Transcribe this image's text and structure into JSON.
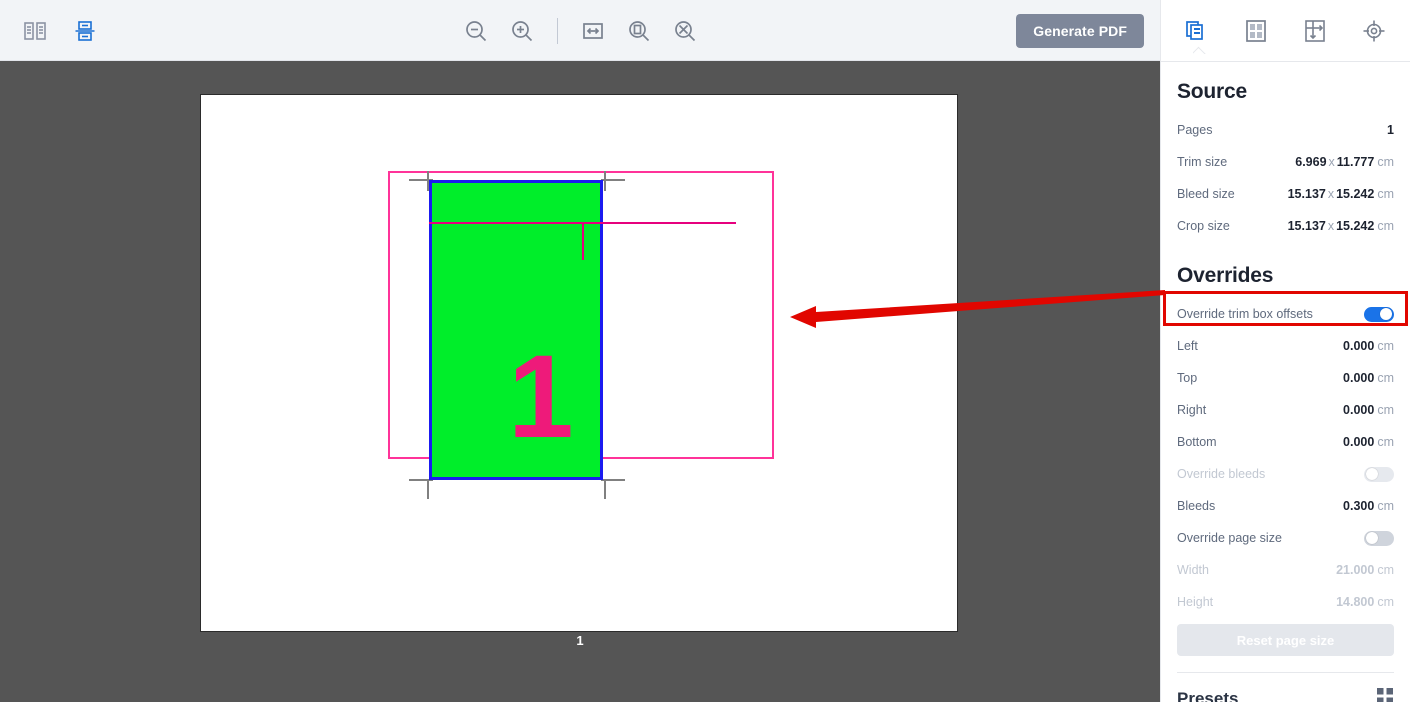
{
  "toolbar": {
    "left_icons": [
      {
        "name": "two-page-spread-icon",
        "state": "inactive"
      },
      {
        "name": "single-page-icon",
        "state": "active"
      }
    ],
    "center_icons": [
      {
        "name": "zoom-out-icon"
      },
      {
        "name": "zoom-in-icon"
      },
      {
        "name": "fit-width-icon"
      },
      {
        "name": "fit-page-icon"
      },
      {
        "name": "actual-size-icon"
      }
    ],
    "generate_pdf_label": "Generate PDF"
  },
  "canvas": {
    "page_label": "1",
    "artwork_numeral": "1",
    "colors": {
      "background": "#555555",
      "sheet": "#ffffff",
      "bleed_box": "#ff3399",
      "trim_box_border": "#1b1bf0",
      "artwork_fill": "#00ee2a",
      "crop_marks": "#808080",
      "guides": "#e6007e"
    }
  },
  "panel": {
    "tabs": [
      {
        "name": "source-tab",
        "icon": "stacked-pages-icon",
        "active": true
      },
      {
        "name": "layout-tab",
        "icon": "grid-pages-icon",
        "active": false
      },
      {
        "name": "offsets-tab",
        "icon": "offset-arrows-icon",
        "active": false
      },
      {
        "name": "marks-tab",
        "icon": "registration-target-icon",
        "active": false
      }
    ],
    "source": {
      "title": "Source",
      "rows": [
        {
          "label": "Pages",
          "value": "1",
          "unit": ""
        },
        {
          "label": "Trim size",
          "value_w": "6.969",
          "value_h": "11.777",
          "unit": "cm"
        },
        {
          "label": "Bleed size",
          "value_w": "15.137",
          "value_h": "15.242",
          "unit": "cm"
        },
        {
          "label": "Crop size",
          "value_w": "15.137",
          "value_h": "15.242",
          "unit": "cm"
        }
      ]
    },
    "overrides": {
      "title": "Overrides",
      "trim_toggle_label": "Override trim box offsets",
      "trim_toggle_state": "on",
      "left_label": "Left",
      "left_value": "0.000",
      "left_unit": "cm",
      "top_label": "Top",
      "top_value": "0.000",
      "top_unit": "cm",
      "right_label": "Right",
      "right_value": "0.000",
      "right_unit": "cm",
      "bottom_label": "Bottom",
      "bottom_value": "0.000",
      "bottom_unit": "cm",
      "bleeds_toggle_label": "Override bleeds",
      "bleeds_toggle_state": "off-disabled",
      "bleeds_label": "Bleeds",
      "bleeds_value": "0.300",
      "bleeds_unit": "cm",
      "page_size_toggle_label": "Override page size",
      "page_size_toggle_state": "off",
      "width_label": "Width",
      "width_value": "21.000",
      "width_unit": "cm",
      "height_label": "Height",
      "height_value": "14.800",
      "height_unit": "cm",
      "reset_label": "Reset page size"
    },
    "presets": {
      "title": "Presets",
      "grid_icon": "preset-grid-icon"
    }
  },
  "annotations": {
    "highlight_color": "#e10600",
    "arrow_color": "#e10600",
    "highlight_target": "Override trim box offsets"
  }
}
